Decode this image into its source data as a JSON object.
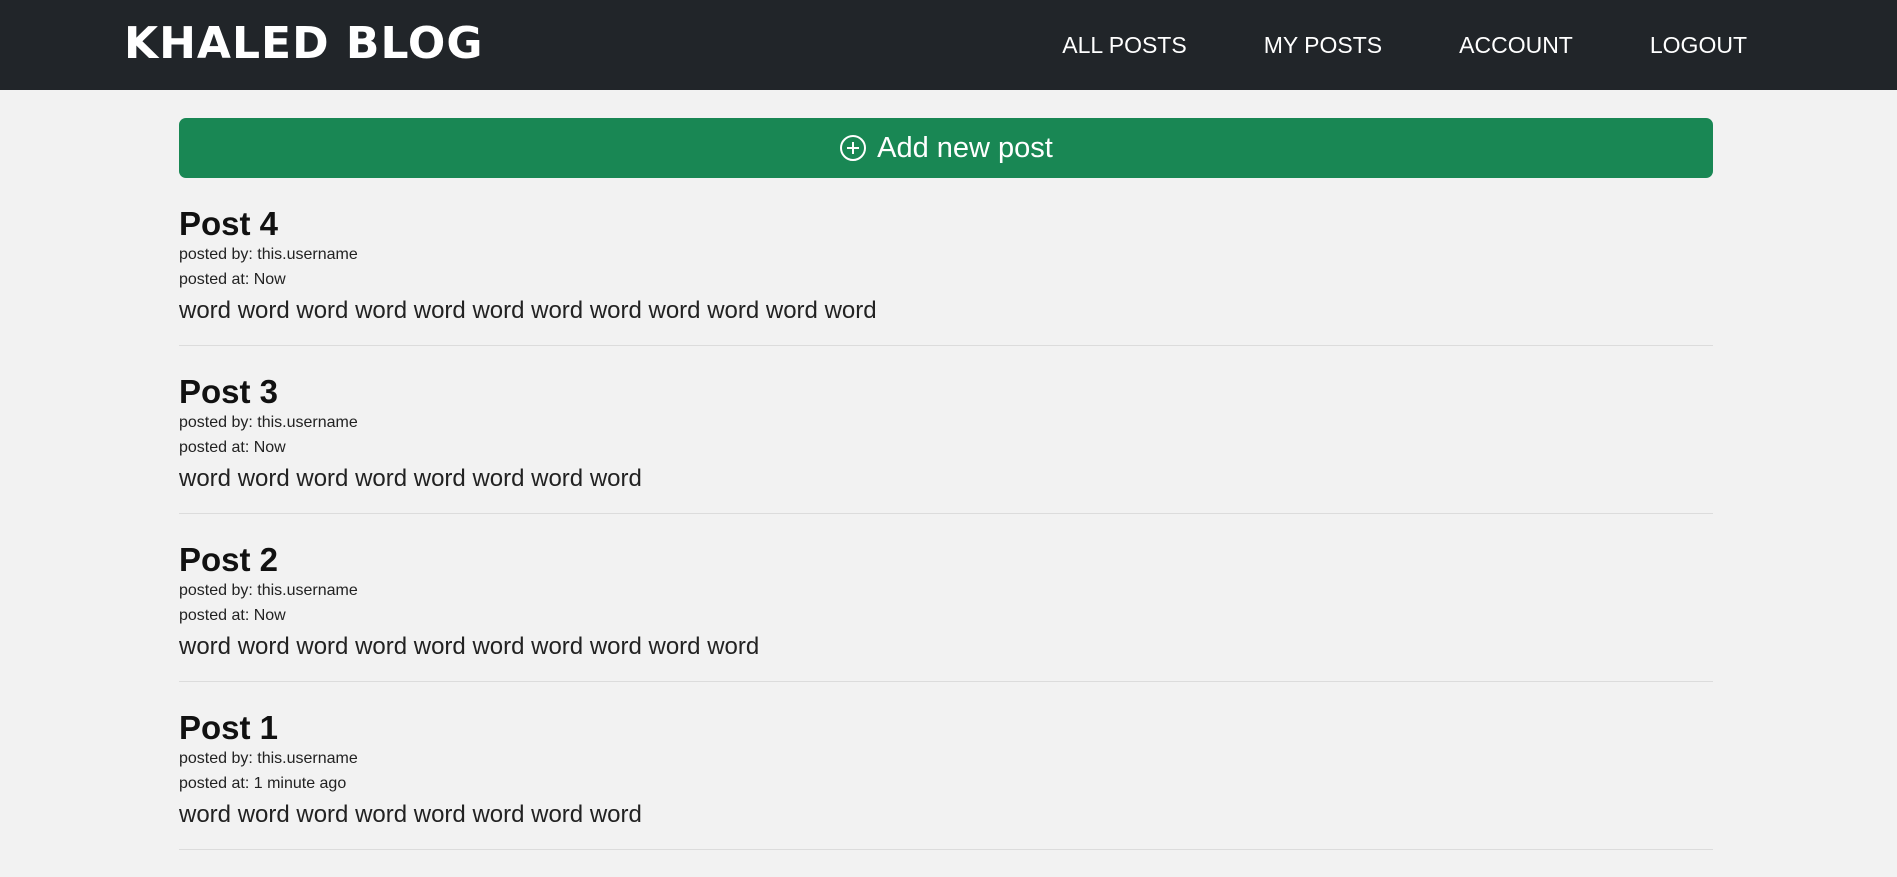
{
  "navbar": {
    "brand": "KHALED BLOG",
    "links": [
      "ALL POSTS",
      "MY POSTS",
      "ACCOUNT",
      "LOGOUT"
    ]
  },
  "add_button": {
    "label": "Add new post",
    "icon": "plus-circle-icon",
    "color": "#198754"
  },
  "posts": [
    {
      "title": "Post 4",
      "posted_by": "posted by: this.username",
      "posted_at": "posted at: Now",
      "body": "word word word word word word word word word word word word"
    },
    {
      "title": "Post 3",
      "posted_by": "posted by: this.username",
      "posted_at": "posted at: Now",
      "body": "word word word word word word word word"
    },
    {
      "title": "Post 2",
      "posted_by": "posted by: this.username",
      "posted_at": "posted at: Now",
      "body": "word word word word word word word word word word"
    },
    {
      "title": "Post 1",
      "posted_by": "posted by: this.username",
      "posted_at": "posted at: 1 minute ago",
      "body": "word word word word word word word word"
    }
  ]
}
